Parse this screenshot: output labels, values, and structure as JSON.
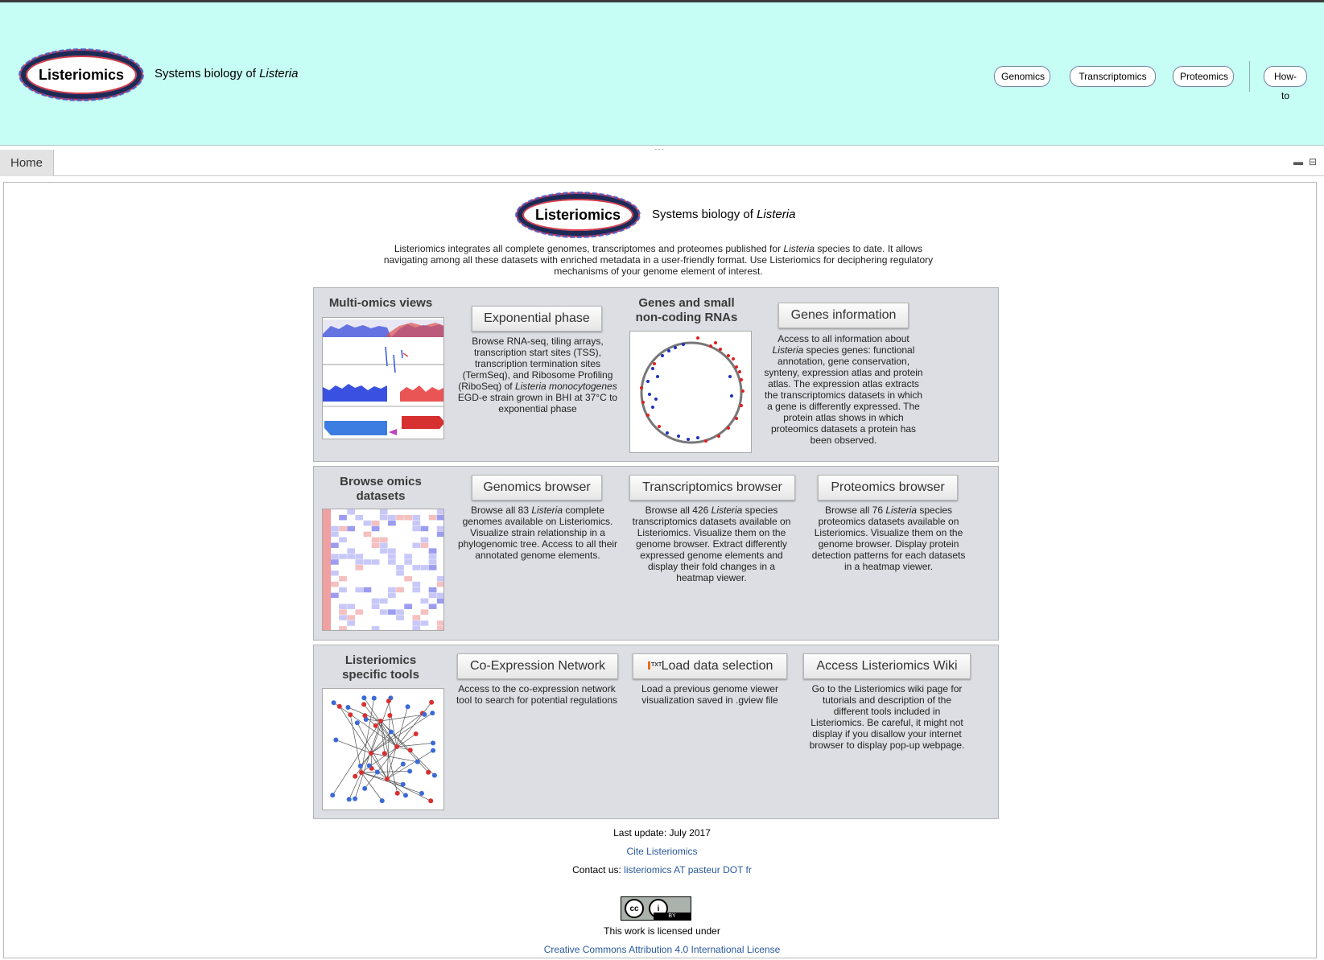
{
  "app": {
    "logo_text": "Listeriomics",
    "tagline_prefix": "Systems biology of ",
    "tagline_species": "Listeria"
  },
  "nav": {
    "items": [
      "Genomics",
      "Transcriptomics",
      "Proteomics",
      "How-to"
    ]
  },
  "tabs": [
    {
      "label": "Home"
    }
  ],
  "intro": {
    "p1": "Listeriomics integrates all complete genomes, transcriptomes and proteomes published for ",
    "species": "Listeria",
    "p2": " species to date. It allows navigating among all these datasets with enriched metadata in a user-friendly format. Use Listeriomics for deciphering regulatory mechanisms of your genome element of interest."
  },
  "sections": {
    "multi": {
      "title": "Multi-omics views",
      "button": "Exponential phase",
      "desc_a": "Browse RNA-seq, tiling arrays, transcription start sites (TSS), transcription termination sites (TermSeq), and Ribosome Profiling (RiboSeq) of ",
      "desc_species": "Listeria monocytogenes",
      "desc_b": " EGD-e strain grown in BHI at 37°C to exponential phase",
      "genes_title": "Genes and small non-coding RNAs",
      "genes_button": "Genes information",
      "genes_desc_a": "Access to all information about ",
      "genes_desc_species": "Listeria",
      "genes_desc_b": " species genes: functional annotation, gene conservation, synteny, expression atlas and protein atlas. The expression atlas extracts the transcriptomics datasets in which a gene is differently expressed. The protein atlas shows in which proteomics datasets a protein has been observed."
    },
    "browse": {
      "title": "Browse omics datasets",
      "genomics_button": "Genomics browser",
      "genomics_desc_a": "Browse all 83 ",
      "genomics_desc_species": "Listeria",
      "genomics_desc_b": " complete genomes available on Listeriomics. Visualize strain relationship in a phylogenomic tree. Access to all their annotated genome elements.",
      "transcriptomics_button": "Transcriptomics browser",
      "transcriptomics_desc_a": "Browse all 426 ",
      "transcriptomics_desc_species": "Listeria",
      "transcriptomics_desc_b": " species transcriptomics datasets available on Listeriomics. Visualize them on the genome browser. Extract differently expressed genome elements and display their fold changes in a heatmap viewer.",
      "proteomics_button": "Proteomics browser",
      "proteomics_desc_a": "Browse all 76 ",
      "proteomics_desc_species": "Listeria",
      "proteomics_desc_b": " species proteomics datasets available on Listeriomics. Visualize them on the genome browser. Display protein detection patterns for each datasets in a heatmap viewer."
    },
    "tools": {
      "title": "Listeriomics specific tools",
      "coexp_button": "Co-Expression Network",
      "coexp_desc": "Access to the co-expression network tool to search for potential regulations",
      "load_button": "Load data selection",
      "load_icon_text": "TXT",
      "load_desc": "Load a previous genome viewer visualization saved in .gview file",
      "wiki_button": "Access Listeriomics Wiki",
      "wiki_desc": "Go to the Listeriomics wiki page for tutorials and description of the different tools included in Listeriomics. Be careful, it might not display if you disallow your internet browser to display pop-up webpage."
    }
  },
  "footer": {
    "last_update": "Last update: July 2017",
    "cite": "Cite Listeriomics",
    "contact_label": "Contact us: ",
    "contact_link": "listeriomics AT pasteur DOT fr",
    "license_text": "This work is licensed under",
    "license_link": "Creative Commons Attribution 4.0 International License",
    "cc_badge": "BY"
  },
  "colors": {
    "header_bg": "#c6fdf4",
    "section_bg": "#dcdee3",
    "link": "#2a5a9c"
  }
}
